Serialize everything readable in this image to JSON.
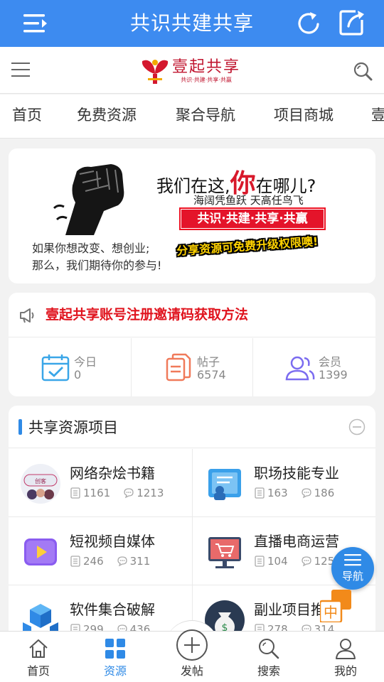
{
  "appbar": {
    "title": "共识共建共享",
    "background": "#3d8bf0"
  },
  "site_header": {
    "brand": "壹起共享",
    "slogan": "共识·共建·共享·共赢",
    "icons": [
      "hamburger-icon",
      "search-icon"
    ]
  },
  "nav_tabs": [
    "首页",
    "免费资源",
    "聚合导航",
    "项目商城",
    "壹"
  ],
  "banner": {
    "headline_pre": "我们在这,",
    "headline_big": "你",
    "headline_post": "在哪儿?",
    "subline": "海阔凭鱼跃  天高任鸟飞",
    "redbar": "共识·共建·共享·共赢",
    "line1": "如果你想改变、想创业;",
    "line2": "那么，我们期待你的参与!",
    "promo": "分享资源可免费升级权限噢!"
  },
  "notice": {
    "text": "壹起共享账号注册邀请码获取方法"
  },
  "stats": [
    {
      "label": "今日",
      "value": "0",
      "icon": "calendar-check-icon",
      "color": "#3aa6e8"
    },
    {
      "label": "帖子",
      "value": "6574",
      "icon": "documents-icon",
      "color": "#f07a5a"
    },
    {
      "label": "会员",
      "value": "1399",
      "icon": "users-icon",
      "color": "#7b6cf0"
    }
  ],
  "projects": {
    "title": "共享资源项目",
    "items": [
      {
        "name": "网络杂烩书籍",
        "threads": "1161",
        "replies": "1213"
      },
      {
        "name": "职场技能专业",
        "threads": "163",
        "replies": "186"
      },
      {
        "name": "短视频自媒体",
        "threads": "246",
        "replies": "311"
      },
      {
        "name": "直播电商运营",
        "threads": "104",
        "replies": "125"
      },
      {
        "name": "软件集合破解",
        "threads": "299",
        "replies": "436"
      },
      {
        "name": "副业项目推荐",
        "threads": "278",
        "replies": "314"
      }
    ]
  },
  "fab": {
    "label": "导航"
  },
  "lang_badge": {
    "text": "中"
  },
  "tabbar": {
    "items": [
      {
        "label": "首页",
        "icon": "home-icon"
      },
      {
        "label": "资源",
        "icon": "grid-icon",
        "active": true
      },
      {
        "label": "发帖",
        "icon": "plus-circle-icon"
      },
      {
        "label": "搜索",
        "icon": "search-icon"
      },
      {
        "label": "我的",
        "icon": "user-icon"
      }
    ],
    "active_color": "#2f8ae6"
  }
}
